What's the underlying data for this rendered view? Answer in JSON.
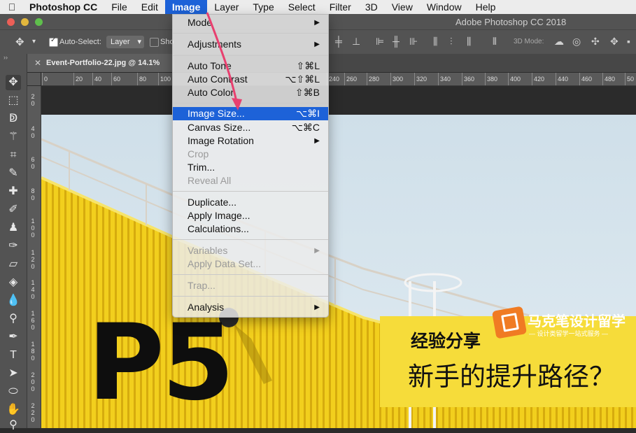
{
  "menubar": {
    "app": "Photoshop CC",
    "items": [
      "File",
      "Edit",
      "Image",
      "Layer",
      "Type",
      "Select",
      "Filter",
      "3D",
      "View",
      "Window",
      "Help"
    ],
    "active": "Image"
  },
  "window": {
    "title": "Adobe Photoshop CC 2018"
  },
  "options_bar": {
    "auto_select_label": "Auto-Select:",
    "auto_select_checked": true,
    "auto_select_target": "Layer",
    "show_label": "Sho",
    "mode_3d_label": "3D Mode:"
  },
  "document": {
    "tab_label": "Event-Portfolio-22.jpg @ 14.1%"
  },
  "ruler": {
    "h_ticks": [
      "0",
      "20",
      "40",
      "60",
      "80",
      "100",
      "240",
      "260",
      "280",
      "300",
      "320",
      "340",
      "360",
      "380",
      "400",
      "420",
      "440",
      "460",
      "480",
      "50"
    ],
    "v_ticks": [
      "2 0",
      "4 0",
      "6 0",
      "8 0",
      "1 0 0",
      "1 2 0",
      "1 4 0",
      "1 6 0",
      "1 8 0",
      "2 0 0",
      "2 2 0"
    ]
  },
  "image_menu": {
    "items": [
      {
        "label": "Mode",
        "submenu": true
      },
      {
        "separator": true
      },
      {
        "label": "Adjustments",
        "submenu": true
      },
      {
        "separator": true
      },
      {
        "label": "Auto Tone",
        "shortcut": "⇧⌘L"
      },
      {
        "label": "Auto Contrast",
        "shortcut": "⌥⇧⌘L"
      },
      {
        "label": "Auto Color",
        "shortcut": "⇧⌘B"
      },
      {
        "separator": true
      },
      {
        "label": "Image Size...",
        "shortcut": "⌥⌘I",
        "highlighted": true
      },
      {
        "label": "Canvas Size...",
        "shortcut": "⌥⌘C"
      },
      {
        "label": "Image Rotation",
        "submenu": true
      },
      {
        "label": "Crop",
        "disabled": true
      },
      {
        "label": "Trim..."
      },
      {
        "label": "Reveal All",
        "disabled": true
      },
      {
        "separator": true
      },
      {
        "label": "Duplicate..."
      },
      {
        "label": "Apply Image..."
      },
      {
        "label": "Calculations..."
      },
      {
        "separator": true
      },
      {
        "label": "Variables",
        "submenu": true,
        "disabled": true
      },
      {
        "label": "Apply Data Set...",
        "disabled": true
      },
      {
        "separator": true
      },
      {
        "label": "Trap...",
        "disabled": true
      },
      {
        "separator": true
      },
      {
        "label": "Analysis",
        "submenu": true
      }
    ]
  },
  "artwork": {
    "big_text": "P5",
    "banner_sub": "经验分享",
    "banner_main": "新手的提升路径？",
    "logo_name": "马克笔设计留学",
    "logo_tag": "— 设计类留学一站式服务 —"
  },
  "colors": {
    "menu_highlight": "#1d62d8",
    "building_yellow": "#f2cf1d",
    "banner_yellow": "#f6dc3a",
    "logo_orange": "#f07b23",
    "annotation_arrow": "#e8406f"
  }
}
